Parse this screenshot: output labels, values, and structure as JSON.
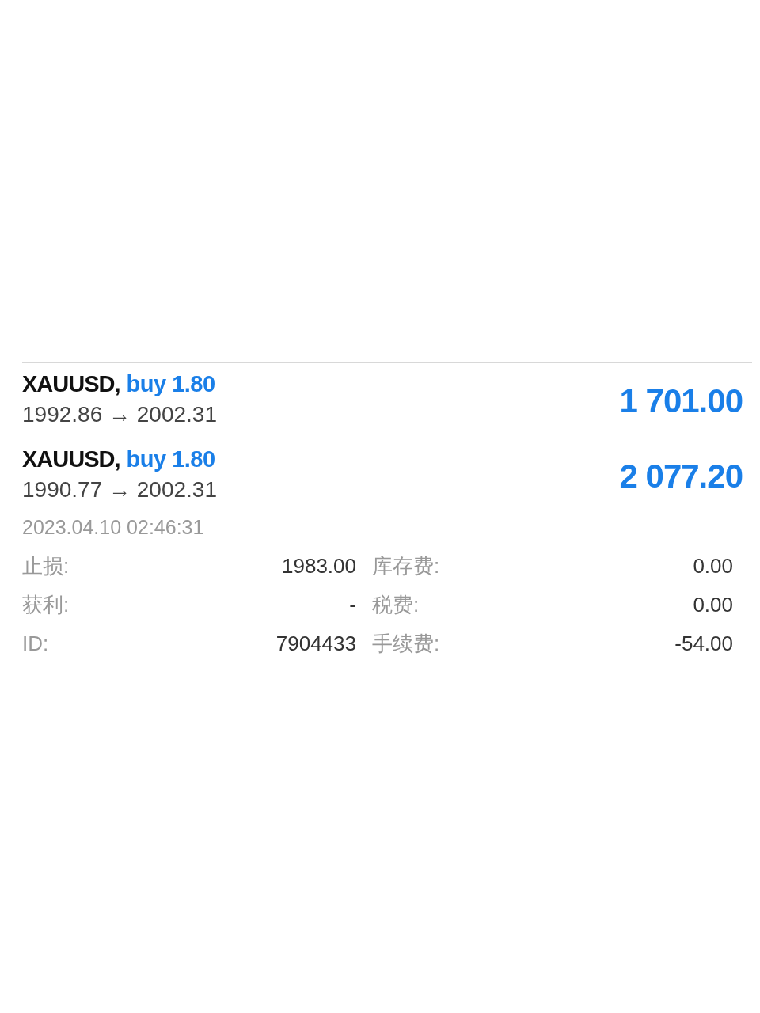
{
  "positions": [
    {
      "symbol": "XAUUSD,",
      "side": "buy 1.80",
      "prices": "1992.86 → 2002.31",
      "profit": "1 701.00"
    },
    {
      "symbol": "XAUUSD,",
      "side": "buy 1.80",
      "prices": "1990.77 → 2002.31",
      "profit": "2 077.20",
      "time": "2023.04.10 02:46:31",
      "details": [
        {
          "label": "止损:",
          "value": "1983.00",
          "label2": "库存费:",
          "value2": "0.00"
        },
        {
          "label": "获利:",
          "value": "-",
          "label2": "税费:",
          "value2": "0.00"
        },
        {
          "label": "ID:",
          "value": "7904433",
          "label2": "手续费:",
          "value2": "-54.00"
        }
      ]
    }
  ]
}
